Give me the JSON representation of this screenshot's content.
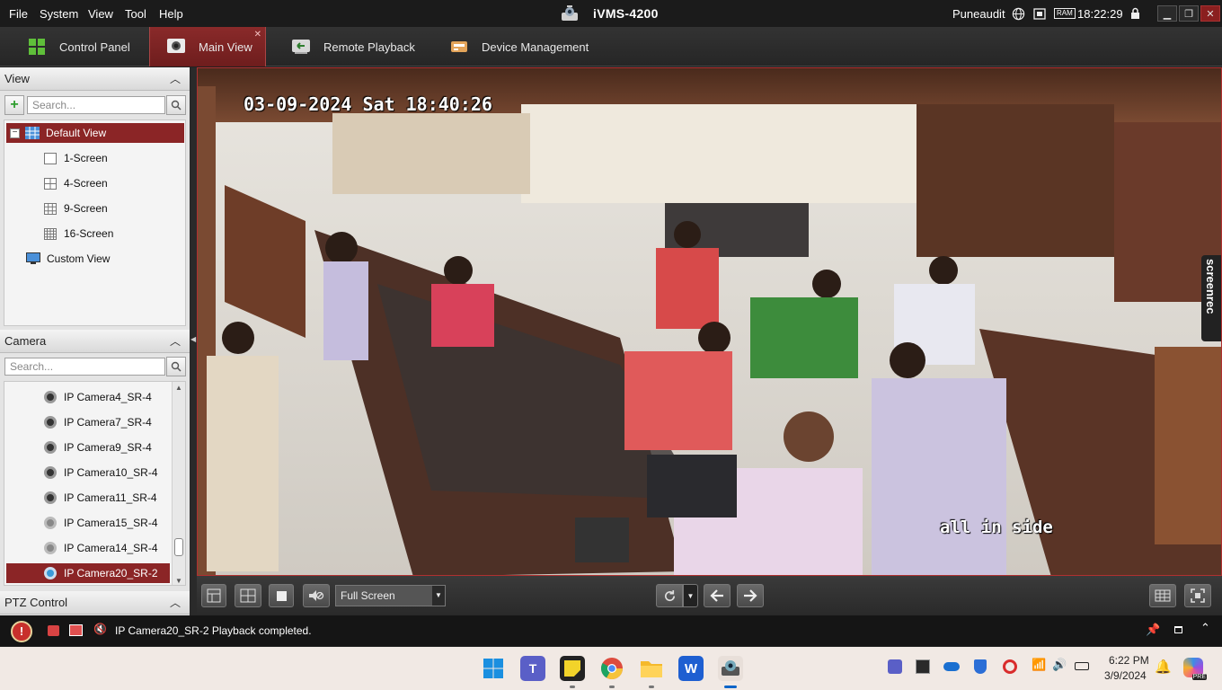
{
  "menu": {
    "file": "File",
    "system": "System",
    "view": "View",
    "tool": "Tool",
    "help": "Help"
  },
  "app": {
    "title": "iVMS-4200",
    "user": "Puneaudit",
    "ram_label": "RAM",
    "time": "18:22:29"
  },
  "tabs": [
    {
      "label": "Control Panel"
    },
    {
      "label": "Main View"
    },
    {
      "label": "Remote Playback"
    },
    {
      "label": "Device Management"
    }
  ],
  "view_panel": {
    "title": "View",
    "search_placeholder": "Search...",
    "items": [
      {
        "label": "Default View"
      },
      {
        "label": "1-Screen"
      },
      {
        "label": "4-Screen"
      },
      {
        "label": "9-Screen"
      },
      {
        "label": "16-Screen"
      },
      {
        "label": "Custom View"
      }
    ]
  },
  "camera_panel": {
    "title": "Camera",
    "search_placeholder": "Search...",
    "cameras": [
      {
        "label": "IP Camera4_SR-4"
      },
      {
        "label": "IP Camera7_SR-4"
      },
      {
        "label": "IP Camera9_SR-4"
      },
      {
        "label": "IP Camera10_SR-4"
      },
      {
        "label": "IP Camera11_SR-4"
      },
      {
        "label": "IP Camera15_SR-4"
      },
      {
        "label": "IP Camera14_SR-4"
      },
      {
        "label": "IP Camera20_SR-2"
      }
    ]
  },
  "ptz": {
    "title": "PTZ Control"
  },
  "video": {
    "timestamp": "03-09-2024 Sat 18:40:26",
    "overlay_text": "all in side",
    "watermark": "screenrec"
  },
  "toolbar": {
    "screen_mode": "Full Screen"
  },
  "status": {
    "message": "IP Camera20_SR-2 Playback completed."
  },
  "taskbar": {
    "time": "6:22 PM",
    "date": "3/9/2024",
    "copilot_badge": "PRE"
  },
  "colors": {
    "accent": "#8b2526",
    "titlebar": "#1b1b1b",
    "taskbar": "#f1e9e4"
  }
}
